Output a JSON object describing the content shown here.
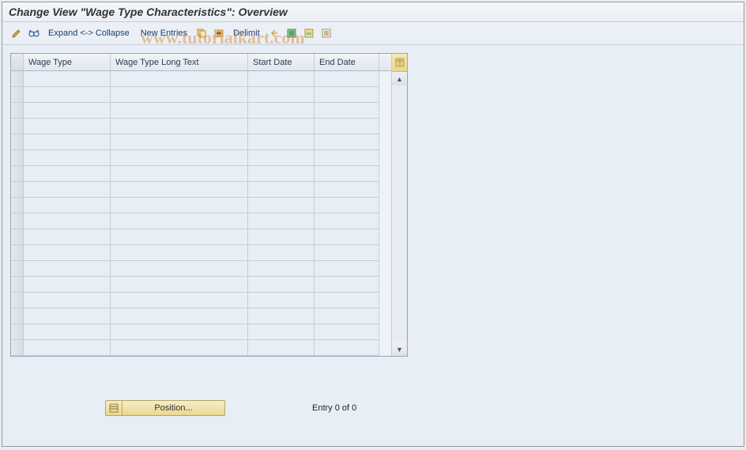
{
  "title": "Change View \"Wage Type Characteristics\": Overview",
  "toolbar": {
    "expand_collapse": "Expand <-> Collapse",
    "new_entries": "New Entries",
    "delimit": "Delimit"
  },
  "table": {
    "columns": {
      "wage_type": "Wage Type",
      "wage_type_long": "Wage Type Long Text",
      "start_date": "Start Date",
      "end_date": "End Date"
    },
    "row_count": 18
  },
  "footer": {
    "position_label": "Position...",
    "entry_status": "Entry 0 of 0"
  },
  "watermark": "www.tutorialkart.com"
}
